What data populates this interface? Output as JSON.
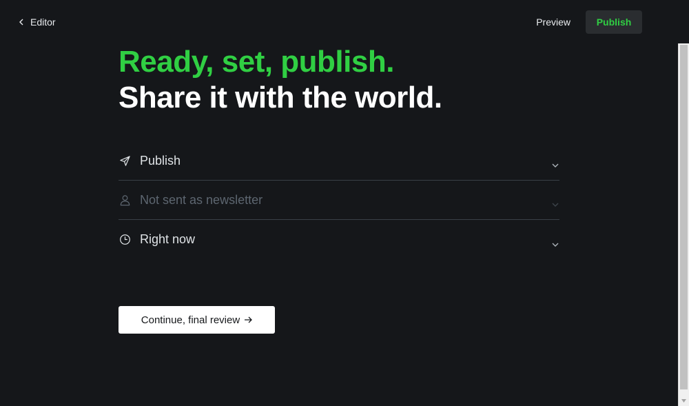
{
  "header": {
    "back_label": "Editor",
    "preview_label": "Preview",
    "publish_label": "Publish"
  },
  "headline": {
    "line1": "Ready, set, publish.",
    "line2": "Share it with the world."
  },
  "options": [
    {
      "icon": "send-icon",
      "label": "Publish",
      "dim": false
    },
    {
      "icon": "user-icon",
      "label": "Not sent as newsletter",
      "dim": true
    },
    {
      "icon": "clock-icon",
      "label": "Right now",
      "dim": false
    }
  ],
  "continue_button": {
    "label": "Continue, final review"
  },
  "colors": {
    "background": "#15171a",
    "accent_green": "#30cf43",
    "divider": "#394047",
    "muted_text": "#5d6670"
  }
}
